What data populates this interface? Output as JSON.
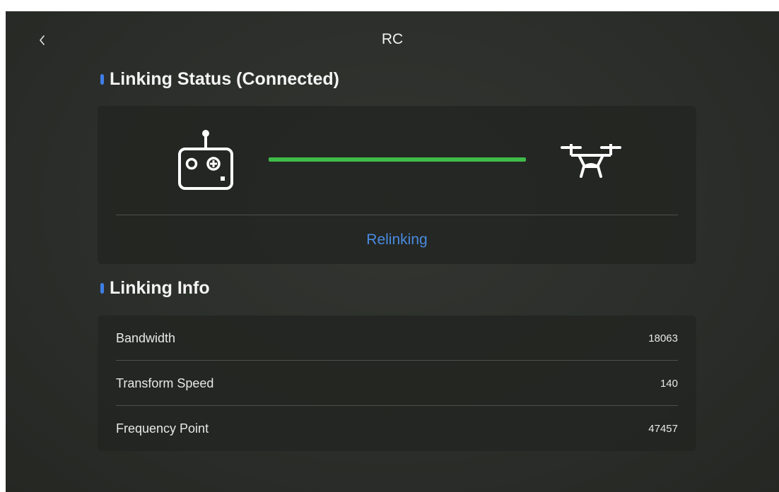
{
  "header": {
    "title": "RC",
    "back_icon": "chevron-left-icon"
  },
  "linking_status": {
    "title": "Linking Status (Connected)",
    "connected": true,
    "link_color": "#3fbb4a",
    "accent_color": "#3f7ee6",
    "remote_icon": "remote-controller-icon",
    "drone_icon": "drone-icon",
    "relink_label": "Relinking"
  },
  "linking_info": {
    "title": "Linking Info",
    "rows": [
      {
        "label": "Bandwidth",
        "value": "18063"
      },
      {
        "label": "Transform Speed",
        "value": "140"
      },
      {
        "label": "Frequency Point",
        "value": "47457"
      }
    ]
  }
}
